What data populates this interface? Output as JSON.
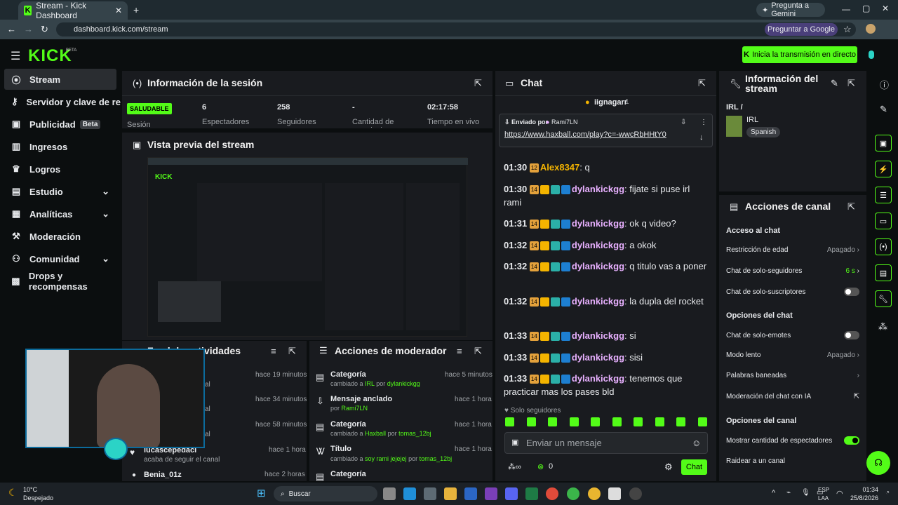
{
  "browser": {
    "tab_title": "Stream - Kick Dashboard",
    "gemini": "Pregunta a Gemini",
    "url": "dashboard.kick.com/stream",
    "google": "Preguntar a Google"
  },
  "header": {
    "logo": "KICK",
    "beta": "BETA",
    "go_live": "Inicia la transmisión en directo"
  },
  "sidebar": [
    {
      "label": "Stream",
      "icon": "stream-icon"
    },
    {
      "label": "Servidor y clave de retransmisión",
      "icon": "key-icon"
    },
    {
      "label": "Publicidad",
      "badge": "Beta",
      "icon": "ad-icon"
    },
    {
      "label": "Ingresos",
      "icon": "chart-icon"
    },
    {
      "label": "Logros",
      "icon": "trophy-icon"
    },
    {
      "label": "Estudio",
      "icon": "studio-icon"
    },
    {
      "label": "Analíticas",
      "icon": "analytics-icon"
    },
    {
      "label": "Moderación",
      "icon": "hammer-icon"
    },
    {
      "label": "Comunidad",
      "icon": "community-icon"
    },
    {
      "label": "Drops y recompensas",
      "icon": "gift-icon"
    }
  ],
  "session": {
    "title": "Información de la sesión",
    "status": "SALUDABLE",
    "status_label": "Sesión",
    "spectators": "6",
    "spectators_label": "Espectadores",
    "followers": "258",
    "followers_label": "Seguidores",
    "subs": "-",
    "subs_label": "Cantidad de suscripciones",
    "live_time": "02:17:58",
    "live_label": "Tiempo en vivo"
  },
  "preview": {
    "title": "Vista previa del stream"
  },
  "activity": {
    "title": "Feed de actividades",
    "items": [
      {
        "time": "hace 19 minutos",
        "text": "al"
      },
      {
        "time": "hace 34 minutos",
        "text": "al"
      },
      {
        "time": "hace 58 minutos",
        "text": "al"
      },
      {
        "name": "lucascepedacl",
        "text": "acaba de seguir el canal",
        "time": "hace 1 hora"
      },
      {
        "name": "Benia_01z",
        "time": "hace 2 horas"
      }
    ]
  },
  "mod": {
    "title": "Acciones de moderador",
    "items": [
      {
        "title": "Categoría",
        "pre": "cambiado a",
        "val": "IRL",
        "by": "por",
        "user": "dylankickgg",
        "time": "hace 5 minutos"
      },
      {
        "title": "Mensaje anclado",
        "by": "por",
        "user": "Rami7LN",
        "time": "hace 1 hora"
      },
      {
        "title": "Categoría",
        "pre": "cambiado a",
        "val": "Haxball",
        "by": "por",
        "user": "tomas_12bj",
        "time": "hace 1 hora"
      },
      {
        "title": "Título",
        "pre": "cambiado a",
        "val": "soy rami jejejej",
        "by": "por",
        "user": "tomas_12bj",
        "time": "hace 1 hora"
      },
      {
        "title": "Categoría",
        "time": ""
      }
    ]
  },
  "chat": {
    "title": "Chat",
    "top_user": "iignagarr",
    "top_count": "1",
    "pinned_by": "Enviado por",
    "pinned_user": "Rami7LN",
    "pinned_link": "https://www.haxball.com/play?c=-wwcRbHHtY0",
    "messages": [
      {
        "time": "01:30",
        "user": "Alex8347",
        "text": ": q"
      },
      {
        "time": "01:30",
        "user": "dylankickgg",
        "text": ": fijate si puse irl rami"
      },
      {
        "time": "01:31",
        "user": "dylankickgg",
        "text": ": ok q video?"
      },
      {
        "time": "01:32",
        "user": "dylankickgg",
        "text": ": a okok"
      },
      {
        "time": "01:32",
        "user": "dylankickgg",
        "text": ": q titulo vas a poner"
      },
      {
        "time": "01:32",
        "user": "dylankickgg",
        "text": ": la dupla del rocket"
      },
      {
        "time": "01:33",
        "user": "dylankickgg",
        "text": ": si"
      },
      {
        "time": "01:33",
        "user": "dylankickgg",
        "text": ": sisi"
      },
      {
        "time": "01:33",
        "user": "dylankickgg",
        "text": ": tenemos que practicar mas los pases bld"
      }
    ],
    "followers_only": "Solo seguidores",
    "placeholder": "Enviar un mensaje",
    "points": "0",
    "send": "Chat"
  },
  "stream_info": {
    "title": "Información del stream",
    "category_path": "IRL /",
    "category": "IRL",
    "language": "Spanish"
  },
  "channel": {
    "title": "Acciones de canal",
    "access": "Acceso al chat",
    "age": "Restricción de edad",
    "age_val": "Apagado",
    "followers_only": "Chat de solo-seguidores",
    "followers_val": "6 s",
    "subs_only": "Chat de solo-suscriptores",
    "chat_opts": "Opciones del chat",
    "emotes": "Chat de solo-emotes",
    "slow": "Modo lento",
    "slow_val": "Apagado",
    "banned": "Palabras baneadas",
    "ai": "Moderación del chat con IA",
    "channel_opts": "Opciones del canal",
    "show_viewers": "Mostrar cantidad de espectadores",
    "raid": "Raidear a un canal"
  },
  "taskbar": {
    "temp": "10°C",
    "weather": "Despejado",
    "search": "Buscar",
    "lang": "ESP",
    "lang2": "LAA",
    "time": "01:34",
    "date": "25/8/2026"
  },
  "colors": {
    "brand": "#53fc18",
    "bg": "#0b0e0f",
    "panel": "#191b1f"
  }
}
